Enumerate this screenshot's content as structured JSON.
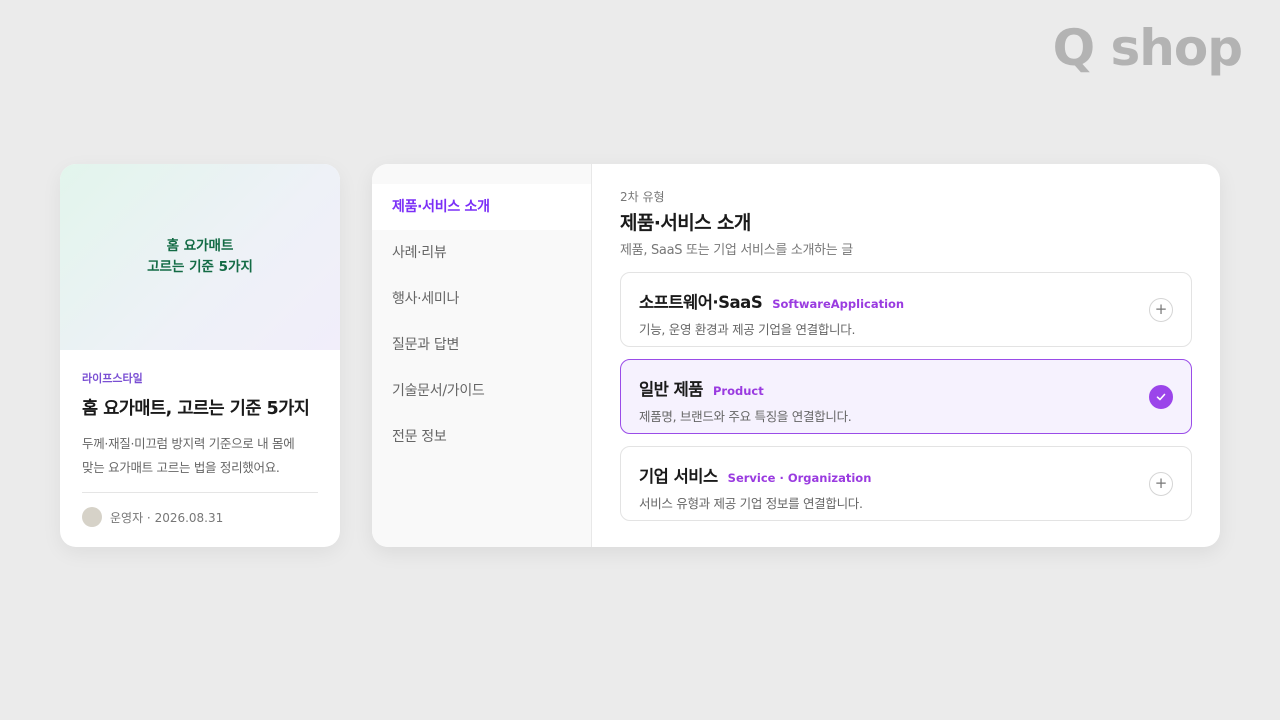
{
  "logo": "Q shop",
  "blog_card": {
    "thumbnail_lines": [
      "홈 요가매트",
      "고르는 기준 5가지"
    ],
    "category": "라이프스타일",
    "title": "홈 요가매트, 고르는 기준 5가지",
    "excerpt_lines": [
      "두께·재질·미끄럼 방지력 기준으로 내 몸에",
      "맞는 요가매트 고르는 법을 정리했어요."
    ],
    "author_date": "운영자 · 2026.08.31"
  },
  "sidebar": {
    "items": [
      {
        "label": "제품·서비스 소개",
        "active": true
      },
      {
        "label": "사례·리뷰",
        "active": false
      },
      {
        "label": "행사·세미나",
        "active": false
      },
      {
        "label": "질문과 답변",
        "active": false
      },
      {
        "label": "기술문서/가이드",
        "active": false
      },
      {
        "label": "전문 정보",
        "active": false
      }
    ]
  },
  "content": {
    "sub_label": "2차 유형",
    "title": "제품·서비스 소개",
    "description": "제품, SaaS 또는 기업 서비스를 소개하는 글",
    "options": [
      {
        "name": "소프트웨어·SaaS",
        "tag": "SoftwareApplication",
        "description": "기능, 운영 환경과 제공 기업을 연결합니다.",
        "selected": false
      },
      {
        "name": "일반 제품",
        "tag": "Product",
        "description": "제품명, 브랜드와 주요 특징을 연결합니다.",
        "selected": true
      },
      {
        "name": "기업 서비스",
        "tag": "Service · Organization",
        "description": "서비스 유형과 제공 기업 정보를 연결합니다.",
        "selected": false
      }
    ]
  },
  "icons": {
    "add": "plus-icon",
    "selected": "check-icon"
  },
  "colors": {
    "accent": "#7b2ff7",
    "thumbnail_text": "#136b45",
    "background": "#ebebeb"
  }
}
